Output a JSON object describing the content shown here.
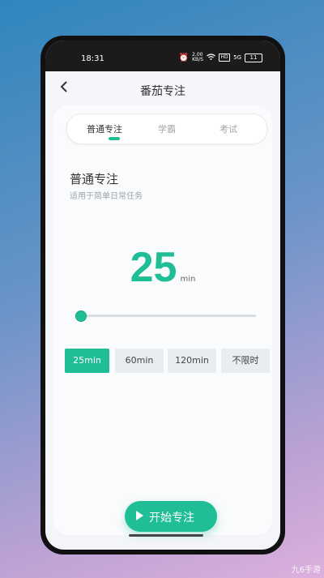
{
  "status_bar": {
    "time": "18:31",
    "data_speed": "2.00 KB/S",
    "network_badge": "HD",
    "signal_label": "5G",
    "battery": "11"
  },
  "header": {
    "back_icon": "chevron-left-icon",
    "title": "番茄专注"
  },
  "tabs": [
    {
      "label": "普通专注",
      "active": true
    },
    {
      "label": "学霸",
      "active": false
    },
    {
      "label": "考试",
      "active": false
    }
  ],
  "mode": {
    "title": "普通专注",
    "subtitle": "适用于简单日常任务"
  },
  "timer": {
    "value": "25",
    "unit": "min"
  },
  "slider": {
    "level": 0.0
  },
  "duration_options": [
    {
      "label": "25min",
      "selected": true
    },
    {
      "label": "60min",
      "selected": false
    },
    {
      "label": "120min",
      "selected": false
    },
    {
      "label": "不限时",
      "selected": false
    }
  ],
  "start_button": {
    "label": "开始专注",
    "icon": "play-icon"
  },
  "watermark": "九6手游",
  "colors": {
    "accent": "#1fbe97",
    "inactive_option": "#e9ecf0"
  }
}
